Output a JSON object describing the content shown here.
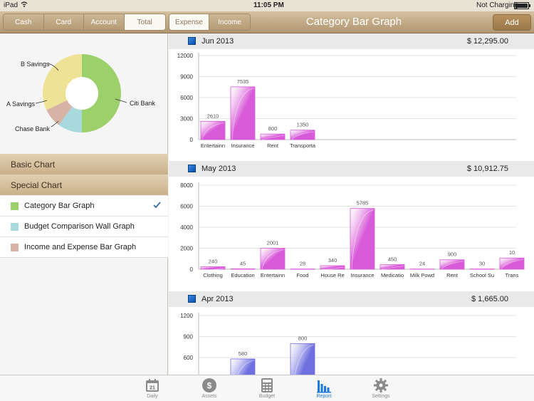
{
  "status_bar": {
    "device": "iPad",
    "time": "11:05 PM",
    "battery": "Not Charging"
  },
  "header": {
    "account_tabs": [
      "Cash",
      "Card",
      "Account",
      "Total"
    ],
    "active_account_tab": "Total",
    "type_tabs": [
      "Expense",
      "Income"
    ],
    "active_type_tab": "Expense",
    "title": "Category Bar Graph",
    "add_label": "Add"
  },
  "pie": {
    "labels": [
      "B Savings",
      "A Savings",
      "Chase Bank",
      "Citi Bank"
    ],
    "slices": [
      {
        "name": "Citi Bank",
        "value": 50,
        "color": "#9cd06b"
      },
      {
        "name": "Chase Bank",
        "value": 10,
        "color": "#a7d9dd"
      },
      {
        "name": "A Savings",
        "value": 8,
        "color": "#d6b3a5"
      },
      {
        "name": "B Savings",
        "value": 32,
        "color": "#eee295"
      }
    ]
  },
  "sidebar": {
    "basic_chart": "Basic Chart",
    "special_chart": "Special Chart",
    "items": [
      {
        "label": "Category Bar Graph",
        "color": "#9cd06b",
        "selected": true
      },
      {
        "label": "Budget Comparison Wall Graph",
        "color": "#a7d9dd",
        "selected": false
      },
      {
        "label": "Income and Expense Bar Graph",
        "color": "#d6b3a5",
        "selected": false
      }
    ]
  },
  "chart_data": [
    {
      "type": "bar",
      "month": "Jun 2013",
      "total": "$ 12,295.00",
      "ylim": [
        0,
        12000
      ],
      "yticks": [
        "0",
        "3000",
        "6000",
        "9000",
        "12000"
      ],
      "categories": [
        "Entertainn",
        "Insurance",
        "Rent",
        "Transporta"
      ],
      "values": [
        2610,
        7535,
        800,
        1350
      ],
      "color": "#d85ad8"
    },
    {
      "type": "bar",
      "month": "May 2013",
      "total": "$ 10,912.75",
      "ylim": [
        0,
        8000
      ],
      "yticks": [
        "0",
        "2000",
        "4000",
        "6000",
        "8000"
      ],
      "categories": [
        "Clothing",
        "Education",
        "Entertainn",
        "Food",
        "House Re",
        "Insurance",
        "Medicatio",
        "Milk Powd",
        "Rent",
        "School Su",
        "Trans"
      ],
      "values": [
        240,
        45,
        2001,
        28,
        340,
        5785,
        450,
        24,
        900,
        30,
        1070
      ],
      "value_labels": [
        "240",
        "45",
        "2001",
        "28",
        "340",
        "5785",
        "450",
        "24",
        "900",
        "30",
        "10"
      ],
      "color": "#d85ad8"
    },
    {
      "type": "bar",
      "month": "Apr 2013",
      "total": "$ 1,665.00",
      "ylim": [
        0,
        1200
      ],
      "yticks": [
        "600",
        "900",
        "1200"
      ],
      "categories": [
        "",
        ""
      ],
      "values": [
        580,
        800
      ],
      "color": "#6f6fe0"
    }
  ],
  "tabbar": [
    {
      "label": "Daily",
      "icon": "calendar-icon",
      "badge": "21"
    },
    {
      "label": "Assets",
      "icon": "dollar-coin-icon"
    },
    {
      "label": "Budget",
      "icon": "calculator-icon"
    },
    {
      "label": "Report",
      "icon": "bar-chart-icon",
      "active": true
    },
    {
      "label": "Settings",
      "icon": "gear-icon"
    }
  ]
}
